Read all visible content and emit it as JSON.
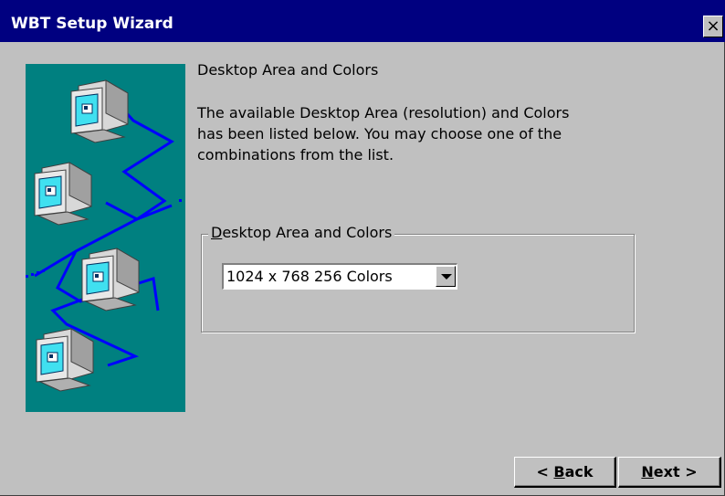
{
  "window": {
    "title": "WBT Setup Wizard",
    "close_glyph": "×"
  },
  "content": {
    "heading": "Desktop Area and Colors",
    "description_lines": [
      "The available Desktop Area (resolution) and Colors",
      "has been listed below.  You may choose one of the",
      "combinations from the list."
    ]
  },
  "group": {
    "label_access_key": "D",
    "label_rest": "esktop Area and Colors",
    "selected_value": "1024 x 768 256 Colors"
  },
  "buttons": {
    "back_prefix": "< ",
    "back_key": "B",
    "back_rest": "ack",
    "next_key": "N",
    "next_rest": "ext >"
  },
  "icons": {
    "close": "close-icon",
    "dropdown": "chevron-down-icon",
    "illustration": "networked-computers-illustration"
  },
  "colors": {
    "titlebar": "#000080",
    "dialog_bg": "#c0c0c0",
    "illustration_bg": "#008080",
    "network_line": "#0000ff"
  }
}
